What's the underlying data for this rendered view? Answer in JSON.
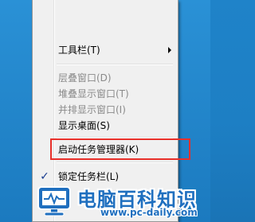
{
  "context_menu": {
    "items": [
      {
        "label": "工具栏(T)",
        "enabled": true,
        "has_submenu": true
      },
      {
        "label": "层叠窗口(D)",
        "enabled": false
      },
      {
        "label": "堆叠显示窗口(T)",
        "enabled": false
      },
      {
        "label": "并排显示窗口(I)",
        "enabled": false
      },
      {
        "label": "显示桌面(S)",
        "enabled": true
      },
      {
        "label": "启动任务管理器(K)",
        "enabled": true,
        "highlighted": true
      },
      {
        "label": "锁定任务栏(L)",
        "enabled": true,
        "checked": true
      }
    ],
    "check_glyph": "✓"
  },
  "watermark": {
    "title": "电脑百科知识",
    "url": "www.pc-daily.com"
  },
  "colors": {
    "desktop": "#1f83c9",
    "menu_bg": "#f0f0f0",
    "highlight_border": "#e8302a",
    "watermark_text": "#1f6fbf"
  }
}
